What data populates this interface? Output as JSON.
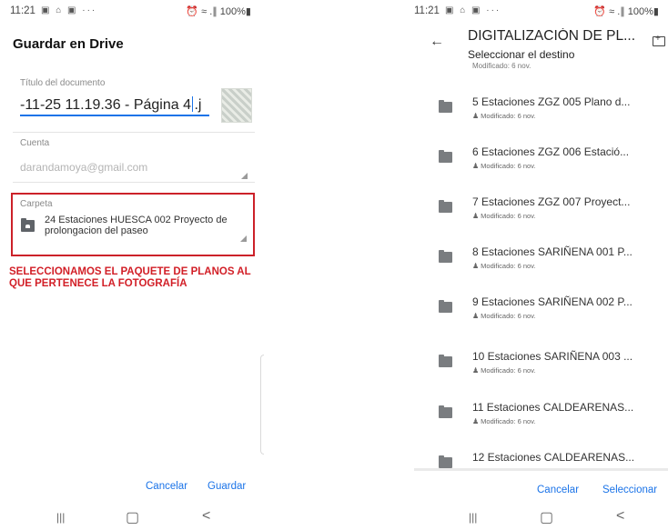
{
  "left": {
    "status": {
      "time": "11:21",
      "icons": "▣ ⌂ ▣ ···",
      "right": "⏰ ≈ .∥ 100%▮"
    },
    "title": "Guardar en Drive",
    "doc_title_label": "Título del documento",
    "doc_title_before_caret": "-11-25 11.19.36 - Página 4",
    "doc_title_after_caret": ".j",
    "account_label": "Cuenta",
    "account_value": "darandamoya@gmail.com",
    "folder_label": "Carpeta",
    "folder_name": "24 Estaciones HUESCA 002  Proyecto de prolongacion del paseo",
    "annotation": "SELECCIONAMOS EL PAQUETE DE PLANOS AL QUE PERTENECE LA FOTOGRAFÍA",
    "cancel_label": "Cancelar",
    "save_label": "Guardar",
    "nav": {
      "recents": "|||",
      "home": "▢",
      "back": "<"
    }
  },
  "right": {
    "status": {
      "time": "11:21",
      "icons": "▣ ⌂ ▣ ···",
      "right": "⏰ ≈ .∥ 100%▮"
    },
    "title": "DIGITALIZACIÓN DE PL...",
    "subtitle": "Seleccionar el destino",
    "clipped_meta": "Modificado: 6 nov.",
    "folders": [
      {
        "name": "5 Estaciones ZGZ 005 Plano d...",
        "meta": "Modificado: 6 nov."
      },
      {
        "name": "6 Estaciones ZGZ 006 Estació...",
        "meta": "Modificado: 6 nov."
      },
      {
        "name": "7 Estaciones ZGZ 007 Proyect...",
        "meta": "Modificado: 6 nov."
      },
      {
        "name": "8 Estaciones SARIÑENA 001 P...",
        "meta": "Modificado: 6 nov."
      },
      {
        "name": "9 Estaciones SARIÑENA 002 P...",
        "meta": "Modificado: 6 nov."
      },
      {
        "name": "10 Estaciones SARIÑENA 003 ...",
        "meta": "Modificado: 6 nov."
      },
      {
        "name": "11 Estaciones CALDEARENAS...",
        "meta": "Modificado: 6 nov."
      },
      {
        "name": "12 Estaciones CALDEARENAS...",
        "meta": ""
      }
    ],
    "cancel_label": "Cancelar",
    "select_label": "Seleccionar",
    "nav": {
      "recents": "|||",
      "home": "▢",
      "back": "<"
    }
  },
  "colors": {
    "accent": "#1a73e8",
    "annotation": "#d21f27",
    "highlight_border": "#cc2129"
  }
}
